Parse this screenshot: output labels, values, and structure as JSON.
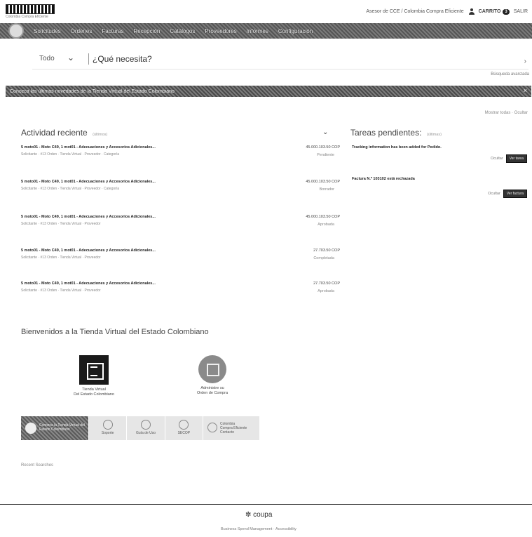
{
  "header": {
    "logo_subtitle": "Colombia Compra Eficiente",
    "user_text": "Asesor de CCE / Colombia Compra Eficiente",
    "cart_label": "CARRITO",
    "cart_count": "3",
    "right_text": "SALIR"
  },
  "nav": {
    "items": [
      "Solicitudes",
      "Órdenes",
      "Facturas",
      "Recepción",
      "Catálogos",
      "Proveedores",
      "Informes",
      "Configuración"
    ]
  },
  "search": {
    "scope": "Todo",
    "placeholder": "¿Qué necesita?",
    "advanced_label": "Búsqueda avanzada"
  },
  "announcement": {
    "text": "Conozca las últimas novedades de la Tienda Virtual del Estado Colombiano"
  },
  "section_links": "Mostrar todas · Ocultar",
  "activity": {
    "title": "Actividad reciente",
    "subtitle": "(últimos)",
    "items": [
      {
        "title": "5 moto01 - Moto C49, 1 mot01 - Adecuaciones y Accesorios Adicionales...",
        "meta": "Solicitante · #13 Orden · Tienda Virtual · Proveedor · Categoría",
        "amount": "45.000.103.50 COP",
        "status": "Pendiente"
      },
      {
        "title": "5 moto01 - Moto C49, 1 mot01 - Adecuaciones y Accesorios Adicionales...",
        "meta": "Solicitante · #13 Orden · Tienda Virtual · Proveedor · Categoría",
        "amount": "45.000.103.50 COP",
        "status": "Borrador"
      },
      {
        "title": "5 moto01 - Moto C49, 1 mot01 - Adecuaciones y Accesorios Adicionales...",
        "meta": "Solicitante · #13 Orden · Tienda Virtual · Proveedor",
        "amount": "45.000.103.50 COP",
        "status": "Aprobada"
      },
      {
        "title": "5 moto01 - Moto C49, 1 mot01 - Adecuaciones y Accesorios Adicionales...",
        "meta": "Solicitante · #13 Orden · Tienda Virtual · Proveedor",
        "amount": "27.703.50 COP",
        "status": "Completada"
      },
      {
        "title": "5 moto01 - Moto C49, 1 mot01 - Adecuaciones y Accesorios Adicionales...",
        "meta": "Solicitante · #13 Orden · Tienda Virtual · Proveedor",
        "amount": "27.703.50 COP",
        "status": "Aprobada"
      }
    ]
  },
  "tasks": {
    "title": "Tareas pendientes:",
    "subtitle": "(últimas)",
    "items": [
      {
        "title": "Tracking information has been added for Pedido.",
        "secondary": "Ocultar",
        "button": "Ver tarea"
      },
      {
        "title": "Factura N.º 103102 está rechazada",
        "secondary": "Ocultar",
        "button": "Ver factura"
      }
    ]
  },
  "welcome": {
    "title": "Bienvenidos a la Tienda Virtual del Estado Colombiano",
    "tiles": [
      {
        "label_1": "Tienda Virtual",
        "label_2": "Del Estado Colombiano"
      },
      {
        "label_1": "Administre su",
        "label_2": "Orden de Compra"
      }
    ],
    "strip": {
      "main": "Conozca la Tienda Virtual del Estado Colombiano",
      "cells": [
        "Soporte",
        "Guía de Uso",
        "SECOP"
      ],
      "last": "Colombia Compra Eficiente Contacto"
    }
  },
  "recent_searches": "Recent Searches",
  "footer": {
    "logo": "coupa",
    "subtitle": "Business Spend Management · Accessibility"
  }
}
